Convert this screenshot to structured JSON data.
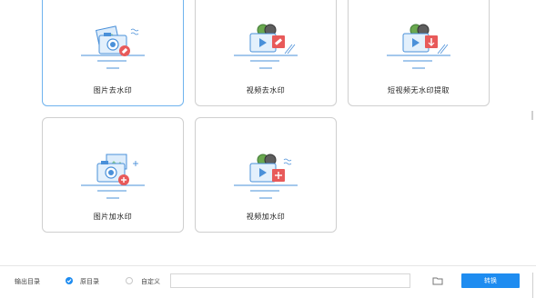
{
  "cards": [
    {
      "label": "图片去水印",
      "icon": "image-remove-watermark-icon",
      "active": true
    },
    {
      "label": "视频去水印",
      "icon": "video-remove-watermark-icon",
      "active": false
    },
    {
      "label": "短视频无水印提取",
      "icon": "short-video-extract-icon",
      "active": false
    },
    {
      "label": "图片加水印",
      "icon": "image-add-watermark-icon",
      "active": false
    },
    {
      "label": "视频加水印",
      "icon": "video-add-watermark-icon",
      "active": false
    }
  ],
  "output": {
    "label": "输出目录",
    "option_original": "原目录",
    "option_custom": "自定义",
    "selected": "原目录",
    "path_value": ""
  },
  "convert_button": "转换",
  "colors": {
    "accent": "#1e8cf0",
    "icon_blue": "#4a90d9",
    "icon_red": "#e85a5a"
  }
}
